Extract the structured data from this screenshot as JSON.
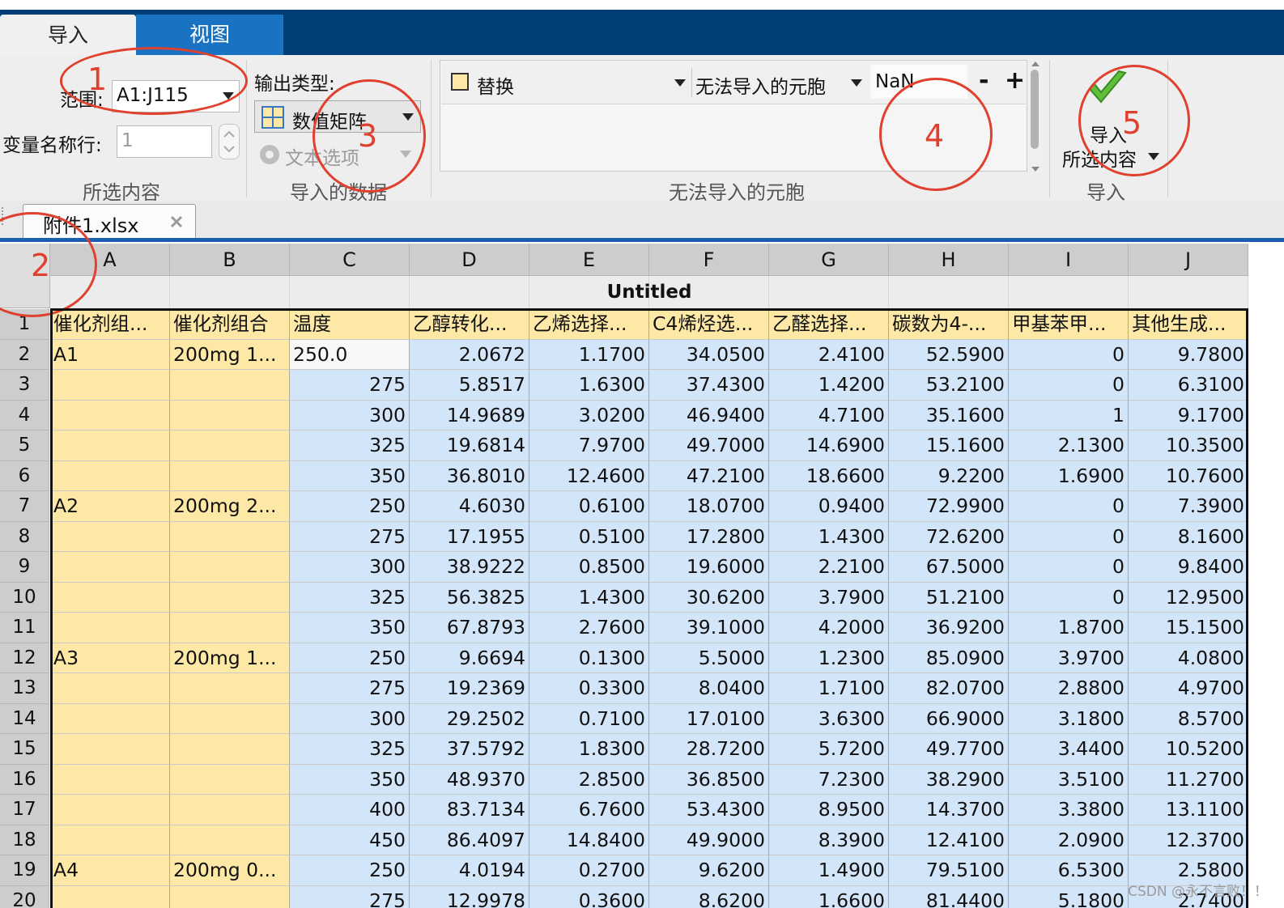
{
  "tabs": {
    "import": "导入",
    "view": "视图"
  },
  "selection": {
    "range_label": "范围:",
    "range_value": "A1:J115",
    "varname_label": "变量名称行:",
    "varname_value": "1",
    "group_label": "所选内容"
  },
  "output": {
    "type_label": "输出类型:",
    "type_value": "数值矩阵",
    "text_options": "文本选项",
    "group_label": "导入的数据"
  },
  "unimportable": {
    "action_label": "替换",
    "condition_label": "无法导入的元胞",
    "value": "NaN",
    "minus": "-",
    "plus": "+",
    "group_label": "无法导入的元胞"
  },
  "import_button": {
    "line1": "导入",
    "line2": "所选内容",
    "group_label": "导入"
  },
  "file_tab": {
    "name": "附件1.xlsx"
  },
  "sheet": {
    "variable_name": "Untitled",
    "columns": [
      "A",
      "B",
      "C",
      "D",
      "E",
      "F",
      "G",
      "H",
      "I",
      "J"
    ],
    "header_row": [
      "催化剂组...",
      "催化剂组合",
      "温度",
      "乙醇转化...",
      "乙烯选择...",
      "C4烯烃选...",
      "乙醛选择...",
      "碳数为4-...",
      "甲基苯甲...",
      "其他生成..."
    ],
    "rows": [
      [
        "2",
        "A1",
        "200mg 1...",
        "250.0",
        "2.0672",
        "1.1700",
        "34.0500",
        "2.4100",
        "52.5900",
        "0",
        "9.7800"
      ],
      [
        "3",
        "",
        "",
        "275",
        "5.8517",
        "1.6300",
        "37.4300",
        "1.4200",
        "53.2100",
        "0",
        "6.3100"
      ],
      [
        "4",
        "",
        "",
        "300",
        "14.9689",
        "3.0200",
        "46.9400",
        "4.7100",
        "35.1600",
        "1",
        "9.1700"
      ],
      [
        "5",
        "",
        "",
        "325",
        "19.6814",
        "7.9700",
        "49.7000",
        "14.6900",
        "15.1600",
        "2.1300",
        "10.3500"
      ],
      [
        "6",
        "",
        "",
        "350",
        "36.8010",
        "12.4600",
        "47.2100",
        "18.6600",
        "9.2200",
        "1.6900",
        "10.7600"
      ],
      [
        "7",
        "A2",
        "200mg 2...",
        "250",
        "4.6030",
        "0.6100",
        "18.0700",
        "0.9400",
        "72.9900",
        "0",
        "7.3900"
      ],
      [
        "8",
        "",
        "",
        "275",
        "17.1955",
        "0.5100",
        "17.2800",
        "1.4300",
        "72.6200",
        "0",
        "8.1600"
      ],
      [
        "9",
        "",
        "",
        "300",
        "38.9222",
        "0.8500",
        "19.6000",
        "2.2100",
        "67.5000",
        "0",
        "9.8400"
      ],
      [
        "10",
        "",
        "",
        "325",
        "56.3825",
        "1.4300",
        "30.6200",
        "3.7900",
        "51.2100",
        "0",
        "12.9500"
      ],
      [
        "11",
        "",
        "",
        "350",
        "67.8793",
        "2.7600",
        "39.1000",
        "4.2000",
        "36.9200",
        "1.8700",
        "15.1500"
      ],
      [
        "12",
        "A3",
        "200mg 1...",
        "250",
        "9.6694",
        "0.1300",
        "5.5000",
        "1.2300",
        "85.0900",
        "3.9700",
        "4.0800"
      ],
      [
        "13",
        "",
        "",
        "275",
        "19.2369",
        "0.3300",
        "8.0400",
        "1.7100",
        "82.0700",
        "2.8800",
        "4.9700"
      ],
      [
        "14",
        "",
        "",
        "300",
        "29.2502",
        "0.7100",
        "17.0100",
        "3.6300",
        "66.9000",
        "3.1800",
        "8.5700"
      ],
      [
        "15",
        "",
        "",
        "325",
        "37.5792",
        "1.8300",
        "28.7200",
        "5.7200",
        "49.7700",
        "3.4400",
        "10.5200"
      ],
      [
        "16",
        "",
        "",
        "350",
        "48.9370",
        "2.8500",
        "36.8500",
        "7.2300",
        "38.2900",
        "3.5100",
        "11.2700"
      ],
      [
        "17",
        "",
        "",
        "400",
        "83.7134",
        "6.7600",
        "53.4300",
        "8.9500",
        "14.3700",
        "3.3800",
        "13.1100"
      ],
      [
        "18",
        "",
        "",
        "450",
        "86.4097",
        "14.8400",
        "49.9000",
        "8.3900",
        "12.4100",
        "2.0900",
        "12.3700"
      ],
      [
        "19",
        "A4",
        "200mg 0...",
        "250",
        "4.0194",
        "0.2700",
        "9.6200",
        "1.4900",
        "79.5100",
        "6.5300",
        "2.5800"
      ],
      [
        "20",
        "",
        "",
        "275",
        "12.9978",
        "0.3600",
        "8.6200",
        "1.6600",
        "81.4400",
        "5.1800",
        "2.7400"
      ]
    ]
  },
  "annotations": [
    "1",
    "2",
    "3",
    "4",
    "5"
  ],
  "watermark": "CSDN @永不言败！！",
  "colors": {
    "header_blue": "#003f76",
    "tab_blue": "#1a73c2",
    "text_col": "#fde8a6",
    "num_col": "#d3e5f9",
    "annotation_red": "#e0402e"
  }
}
